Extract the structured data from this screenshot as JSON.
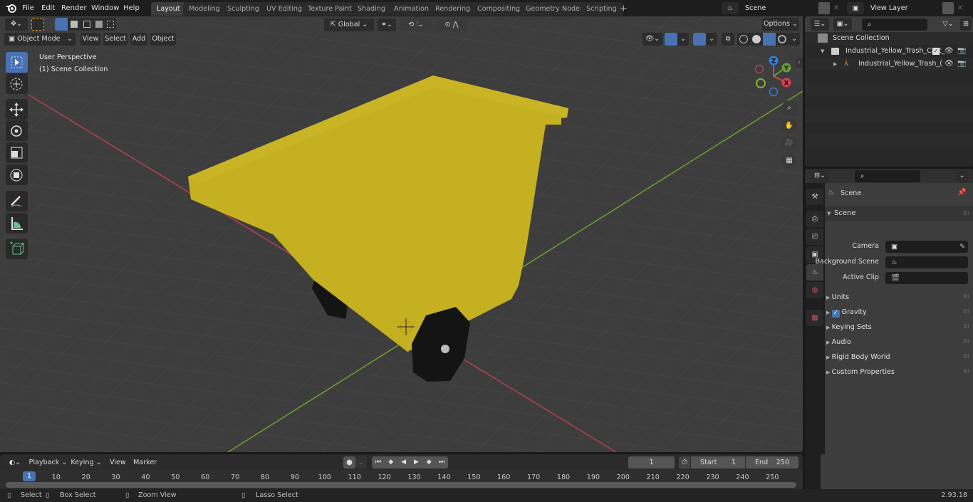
{
  "topbar": {
    "menus": [
      "File",
      "Edit",
      "Render",
      "Window",
      "Help"
    ],
    "workspaces": [
      "Layout",
      "Modeling",
      "Sculpting",
      "UV Editing",
      "Texture Paint",
      "Shading",
      "Animation",
      "Rendering",
      "Compositing",
      "Geometry Nodes",
      "Scripting"
    ],
    "active_workspace": "Layout",
    "add_workspace": "+",
    "scene_name": "Scene",
    "view_layer_name": "View Layer"
  },
  "viewport": {
    "mode": "Object Mode",
    "menus": [
      "View",
      "Select",
      "Add",
      "Object"
    ],
    "transform_orientation": "Global",
    "options_label": "Options",
    "overlay_line1": "User Perspective",
    "overlay_line2": "(1) Scene Collection",
    "gizmo_axes": {
      "x": "X",
      "y": "Y",
      "z": "Z"
    },
    "colors": {
      "cart_yellow": "#c4b020",
      "x_axis": "#d84050",
      "y_axis": "#6a9c30",
      "z_axis": "#2f7de0",
      "grid_bg": "#3d3d3d"
    },
    "tools": [
      "select-box",
      "cursor",
      "move",
      "rotate",
      "scale",
      "transform",
      "annotate",
      "measure",
      "add-cube"
    ]
  },
  "outliner": {
    "root": "Scene Collection",
    "items": [
      {
        "label": "Industrial_Yellow_Trash_Cart_",
        "type": "collection",
        "checked": true
      },
      {
        "label": "Industrial_Yellow_Trash_(",
        "type": "object"
      }
    ]
  },
  "properties": {
    "context_label": "Scene",
    "panel_title": "Scene",
    "fields": [
      {
        "label": "Camera",
        "value": ""
      },
      {
        "label": "Background Scene",
        "value": ""
      },
      {
        "label": "Active Clip",
        "value": ""
      }
    ],
    "sections": [
      {
        "label": "Units"
      },
      {
        "label": "Gravity",
        "checkbox": true
      },
      {
        "label": "Keying Sets"
      },
      {
        "label": "Audio"
      },
      {
        "label": "Rigid Body World"
      },
      {
        "label": "Custom Properties"
      }
    ]
  },
  "timeline": {
    "menus": [
      "Playback",
      "Keying",
      "View",
      "Marker"
    ],
    "current_frame": "1",
    "start_label": "Start",
    "start": "1",
    "end_label": "End",
    "end": "250",
    "ticks": [
      "10",
      "20",
      "30",
      "40",
      "50",
      "60",
      "70",
      "80",
      "90",
      "100",
      "110",
      "120",
      "130",
      "140",
      "150",
      "160",
      "170",
      "180",
      "190",
      "200",
      "210",
      "220",
      "230",
      "240",
      "250"
    ],
    "playhead": "1"
  },
  "statusbar": {
    "items": [
      "Select",
      "Box Select",
      "Zoom View",
      "Lasso Select"
    ],
    "version": "2.93.18"
  }
}
